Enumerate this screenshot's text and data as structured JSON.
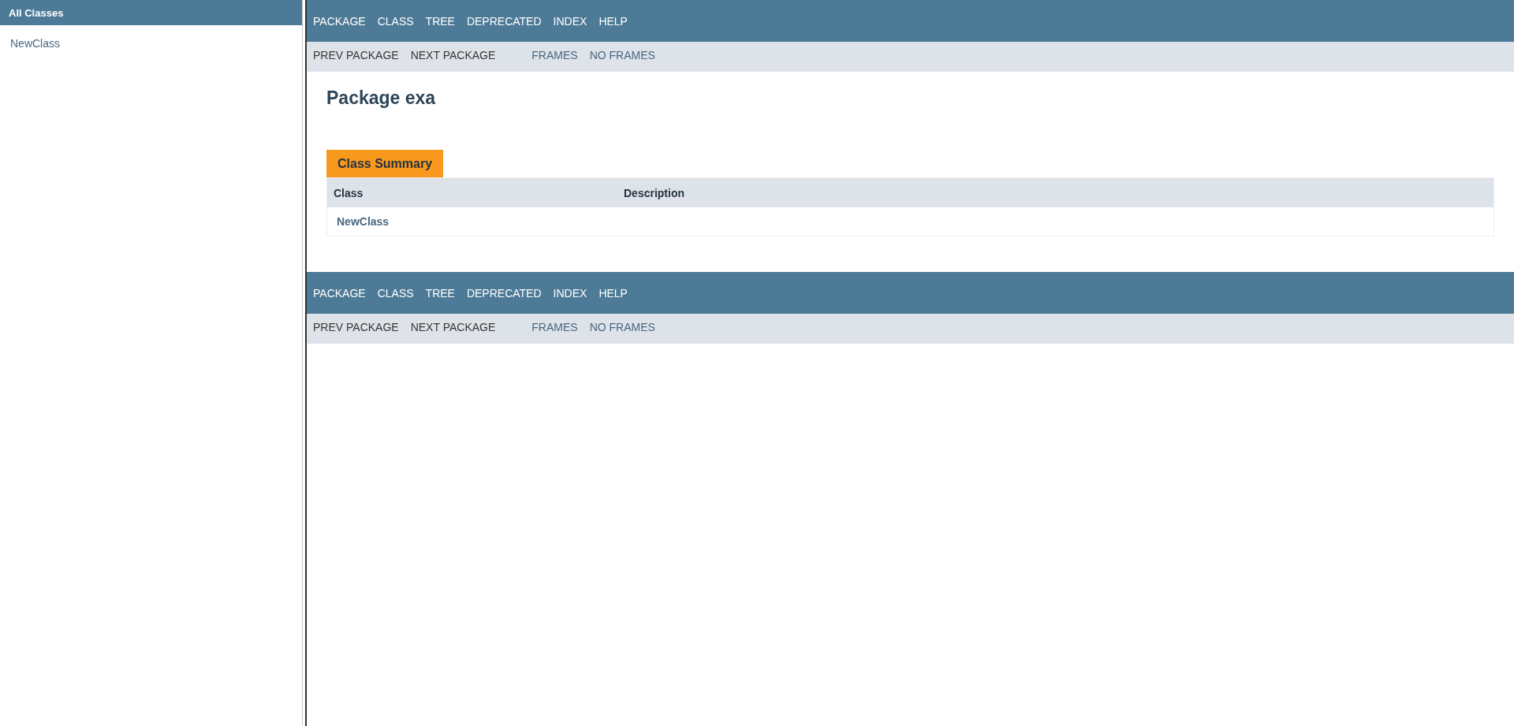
{
  "sidebar": {
    "title": "All Classes",
    "items": [
      "NewClass"
    ]
  },
  "top_nav": {
    "items": [
      "PACKAGE",
      "CLASS",
      "TREE",
      "DEPRECATED",
      "INDEX",
      "HELP"
    ],
    "sub_items": [
      {
        "label": "PREV PACKAGE",
        "link": false
      },
      {
        "label": "NEXT PACKAGE",
        "link": false
      },
      {
        "label": "FRAMES",
        "link": true
      },
      {
        "label": "NO FRAMES",
        "link": true
      }
    ]
  },
  "title": "Package exa",
  "summary": {
    "caption": "Class Summary",
    "columns": [
      "Class",
      "Description"
    ],
    "rows": [
      {
        "class": "NewClass",
        "description": ""
      }
    ]
  },
  "bottom_nav": {
    "items": [
      "PACKAGE",
      "CLASS",
      "TREE",
      "DEPRECATED",
      "INDEX",
      "HELP"
    ],
    "sub_items": [
      {
        "label": "PREV PACKAGE",
        "link": false
      },
      {
        "label": "NEXT PACKAGE",
        "link": false
      },
      {
        "label": "FRAMES",
        "link": true
      },
      {
        "label": "NO FRAMES",
        "link": true
      }
    ]
  }
}
